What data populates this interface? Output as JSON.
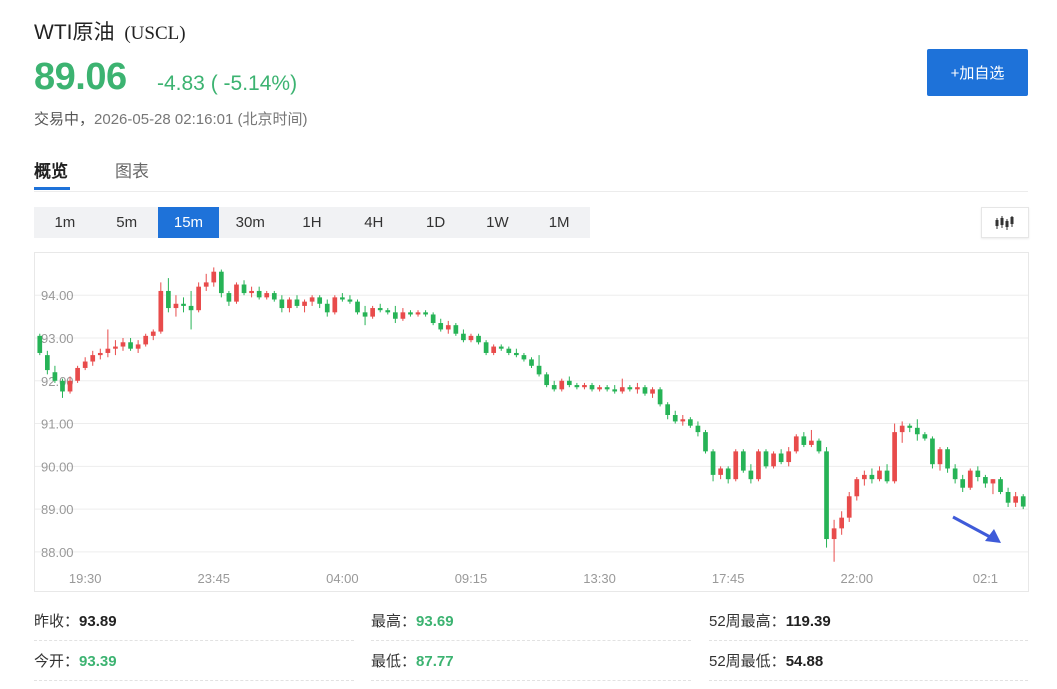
{
  "header": {
    "name": "WTI原油",
    "code": "(USCL)",
    "price": "89.06",
    "change": "-4.83 ( -5.14%)",
    "status": "交易中，",
    "timestamp": "2026-05-28 02:16:01 (北京时间)",
    "add_button": "+加自选"
  },
  "tabs": [
    {
      "label": "概览",
      "active": true
    },
    {
      "label": "图表",
      "active": false
    }
  ],
  "periods": [
    {
      "label": "1m",
      "active": false
    },
    {
      "label": "5m",
      "active": false
    },
    {
      "label": "15m",
      "active": true
    },
    {
      "label": "30m",
      "active": false
    },
    {
      "label": "1H",
      "active": false
    },
    {
      "label": "4H",
      "active": false
    },
    {
      "label": "1D",
      "active": false
    },
    {
      "label": "1W",
      "active": false
    },
    {
      "label": "1M",
      "active": false
    }
  ],
  "kline_button": {
    "icon": "candlestick-icon"
  },
  "colors": {
    "up": "#e84b4b",
    "down": "#26b356",
    "accent": "#1e72d9",
    "price_down": "#3cb371",
    "arrow": "#3f5bd9"
  },
  "chart_data": {
    "type": "candlestick",
    "y_ticks": [
      "94.00",
      "93.00",
      "92.00",
      "91.00",
      "90.00",
      "89.00",
      "88.00"
    ],
    "y_tick_values": [
      94,
      93,
      92,
      91,
      90,
      89,
      88
    ],
    "ylim": [
      87.6,
      94.8
    ],
    "x_ticks": [
      "19:30",
      "23:45",
      "04:00",
      "09:15",
      "13:30",
      "17:45",
      "22:00",
      "02:1"
    ],
    "x_tick_index": [
      6,
      23,
      40,
      57,
      74,
      91,
      108,
      125
    ],
    "grid": true,
    "annotation": "trend-arrow-down",
    "candles": [
      [
        93.05,
        93.1,
        92.6,
        92.65
      ],
      [
        92.6,
        92.7,
        92.15,
        92.25
      ],
      [
        92.2,
        92.35,
        91.95,
        92.0
      ],
      [
        92.0,
        92.05,
        91.6,
        91.75
      ],
      [
        91.75,
        92.1,
        91.7,
        92.0
      ],
      [
        92.0,
        92.35,
        91.95,
        92.3
      ],
      [
        92.3,
        92.55,
        92.25,
        92.45
      ],
      [
        92.45,
        92.7,
        92.35,
        92.6
      ],
      [
        92.6,
        92.75,
        92.5,
        92.65
      ],
      [
        92.65,
        93.2,
        92.55,
        92.75
      ],
      [
        92.75,
        92.95,
        92.6,
        92.8
      ],
      [
        92.8,
        93.0,
        92.7,
        92.9
      ],
      [
        92.9,
        93.0,
        92.7,
        92.75
      ],
      [
        92.75,
        92.95,
        92.65,
        92.85
      ],
      [
        92.85,
        93.1,
        92.8,
        93.05
      ],
      [
        93.05,
        93.2,
        92.95,
        93.15
      ],
      [
        93.15,
        94.3,
        93.1,
        94.1
      ],
      [
        94.1,
        94.4,
        93.6,
        93.7
      ],
      [
        93.7,
        94.0,
        93.5,
        93.8
      ],
      [
        93.8,
        93.95,
        93.6,
        93.75
      ],
      [
        93.75,
        94.1,
        93.2,
        93.65
      ],
      [
        93.65,
        94.3,
        93.6,
        94.2
      ],
      [
        94.2,
        94.5,
        94.1,
        94.3
      ],
      [
        94.3,
        94.65,
        94.2,
        94.55
      ],
      [
        94.55,
        94.6,
        93.95,
        94.05
      ],
      [
        94.05,
        94.1,
        93.75,
        93.85
      ],
      [
        93.85,
        94.3,
        93.8,
        94.25
      ],
      [
        94.25,
        94.35,
        94.0,
        94.05
      ],
      [
        94.05,
        94.2,
        93.95,
        94.1
      ],
      [
        94.1,
        94.2,
        93.9,
        93.95
      ],
      [
        93.95,
        94.1,
        93.9,
        94.05
      ],
      [
        94.05,
        94.1,
        93.85,
        93.9
      ],
      [
        93.9,
        94.0,
        93.6,
        93.7
      ],
      [
        93.7,
        93.95,
        93.6,
        93.9
      ],
      [
        93.9,
        94.0,
        93.7,
        93.75
      ],
      [
        93.75,
        93.9,
        93.6,
        93.85
      ],
      [
        93.85,
        94.0,
        93.75,
        93.95
      ],
      [
        93.95,
        94.0,
        93.7,
        93.8
      ],
      [
        93.8,
        93.9,
        93.5,
        93.6
      ],
      [
        93.6,
        94.0,
        93.55,
        93.95
      ],
      [
        93.95,
        94.05,
        93.85,
        93.9
      ],
      [
        93.9,
        94.0,
        93.8,
        93.85
      ],
      [
        93.85,
        93.9,
        93.55,
        93.6
      ],
      [
        93.6,
        93.75,
        93.3,
        93.5
      ],
      [
        93.5,
        93.75,
        93.45,
        93.7
      ],
      [
        93.7,
        93.8,
        93.6,
        93.65
      ],
      [
        93.65,
        93.7,
        93.55,
        93.6
      ],
      [
        93.6,
        93.75,
        93.35,
        93.45
      ],
      [
        93.45,
        93.7,
        93.4,
        93.6
      ],
      [
        93.6,
        93.65,
        93.5,
        93.55
      ],
      [
        93.55,
        93.65,
        93.5,
        93.6
      ],
      [
        93.6,
        93.65,
        93.5,
        93.55
      ],
      [
        93.55,
        93.6,
        93.3,
        93.35
      ],
      [
        93.35,
        93.45,
        93.15,
        93.2
      ],
      [
        93.2,
        93.4,
        93.1,
        93.3
      ],
      [
        93.3,
        93.35,
        93.05,
        93.1
      ],
      [
        93.1,
        93.2,
        92.9,
        92.95
      ],
      [
        92.95,
        93.1,
        92.9,
        93.05
      ],
      [
        93.05,
        93.1,
        92.85,
        92.9
      ],
      [
        92.9,
        92.95,
        92.6,
        92.65
      ],
      [
        92.65,
        92.85,
        92.6,
        92.8
      ],
      [
        92.8,
        92.85,
        92.7,
        92.75
      ],
      [
        92.75,
        92.8,
        92.6,
        92.65
      ],
      [
        92.65,
        92.75,
        92.55,
        92.6
      ],
      [
        92.6,
        92.65,
        92.45,
        92.5
      ],
      [
        92.5,
        92.55,
        92.3,
        92.35
      ],
      [
        92.35,
        92.6,
        92.1,
        92.15
      ],
      [
        92.15,
        92.2,
        91.85,
        91.9
      ],
      [
        91.9,
        92.0,
        91.75,
        91.8
      ],
      [
        91.8,
        92.05,
        91.75,
        92.0
      ],
      [
        92.0,
        92.1,
        91.85,
        91.9
      ],
      [
        91.9,
        91.95,
        91.8,
        91.85
      ],
      [
        91.85,
        91.95,
        91.8,
        91.9
      ],
      [
        91.9,
        91.95,
        91.75,
        91.8
      ],
      [
        91.8,
        91.9,
        91.75,
        91.85
      ],
      [
        91.85,
        91.9,
        91.75,
        91.8
      ],
      [
        91.8,
        91.9,
        91.7,
        91.75
      ],
      [
        91.75,
        92.05,
        91.7,
        91.85
      ],
      [
        91.85,
        91.9,
        91.75,
        91.8
      ],
      [
        91.8,
        91.95,
        91.7,
        91.85
      ],
      [
        91.85,
        91.9,
        91.65,
        91.7
      ],
      [
        91.7,
        91.85,
        91.6,
        91.8
      ],
      [
        91.8,
        91.85,
        91.4,
        91.45
      ],
      [
        91.45,
        91.5,
        91.1,
        91.2
      ],
      [
        91.2,
        91.3,
        91.0,
        91.05
      ],
      [
        91.05,
        91.2,
        90.95,
        91.1
      ],
      [
        91.1,
        91.15,
        90.9,
        90.95
      ],
      [
        90.95,
        91.05,
        90.7,
        90.8
      ],
      [
        90.8,
        90.85,
        90.3,
        90.35
      ],
      [
        90.35,
        90.4,
        89.65,
        89.8
      ],
      [
        89.8,
        90.0,
        89.7,
        89.95
      ],
      [
        89.95,
        90.0,
        89.6,
        89.7
      ],
      [
        89.7,
        90.4,
        89.65,
        90.35
      ],
      [
        90.35,
        90.4,
        89.85,
        89.9
      ],
      [
        89.9,
        90.05,
        89.6,
        89.7
      ],
      [
        89.7,
        90.4,
        89.65,
        90.35
      ],
      [
        90.35,
        90.4,
        89.95,
        90.0
      ],
      [
        90.0,
        90.35,
        89.95,
        90.3
      ],
      [
        90.3,
        90.4,
        90.05,
        90.1
      ],
      [
        90.1,
        90.45,
        90.0,
        90.35
      ],
      [
        90.35,
        90.75,
        90.3,
        90.7
      ],
      [
        90.7,
        90.8,
        90.45,
        90.5
      ],
      [
        90.5,
        90.85,
        90.45,
        90.6
      ],
      [
        90.6,
        90.65,
        90.3,
        90.35
      ],
      [
        90.35,
        90.45,
        88.1,
        88.3
      ],
      [
        88.3,
        88.75,
        87.77,
        88.55
      ],
      [
        88.55,
        88.95,
        88.4,
        88.8
      ],
      [
        88.8,
        89.4,
        88.7,
        89.3
      ],
      [
        89.3,
        89.75,
        89.2,
        89.7
      ],
      [
        89.7,
        89.9,
        89.55,
        89.8
      ],
      [
        89.8,
        89.95,
        89.6,
        89.7
      ],
      [
        89.7,
        90.0,
        89.65,
        89.9
      ],
      [
        89.9,
        90.05,
        89.6,
        89.65
      ],
      [
        89.65,
        91.0,
        89.6,
        90.8
      ],
      [
        90.8,
        91.05,
        90.55,
        90.95
      ],
      [
        90.95,
        91.0,
        90.8,
        90.9
      ],
      [
        90.9,
        91.1,
        90.6,
        90.75
      ],
      [
        90.75,
        90.8,
        90.6,
        90.65
      ],
      [
        90.65,
        90.7,
        89.95,
        90.05
      ],
      [
        90.05,
        90.45,
        89.9,
        90.4
      ],
      [
        90.4,
        90.45,
        89.85,
        89.95
      ],
      [
        89.95,
        90.05,
        89.6,
        89.7
      ],
      [
        89.7,
        89.8,
        89.4,
        89.5
      ],
      [
        89.5,
        89.95,
        89.45,
        89.9
      ],
      [
        89.9,
        90.0,
        89.65,
        89.75
      ],
      [
        89.75,
        89.8,
        89.5,
        89.6
      ],
      [
        89.6,
        89.7,
        89.35,
        89.7
      ],
      [
        89.7,
        89.75,
        89.35,
        89.4
      ],
      [
        89.4,
        89.5,
        89.05,
        89.15
      ],
      [
        89.15,
        89.4,
        89.05,
        89.3
      ],
      [
        89.3,
        89.35,
        89.0,
        89.06
      ]
    ]
  },
  "stats": [
    [
      {
        "label": "昨收：",
        "value": "93.89",
        "green": false
      },
      {
        "label": "最高：",
        "value": "93.69",
        "green": true
      },
      {
        "label": "52周最高：",
        "value": "119.39",
        "green": false
      }
    ],
    [
      {
        "label": "今开：",
        "value": "93.39",
        "green": true
      },
      {
        "label": "最低：",
        "value": "87.77",
        "green": true
      },
      {
        "label": "52周最低：",
        "value": "54.88",
        "green": false
      }
    ]
  ]
}
